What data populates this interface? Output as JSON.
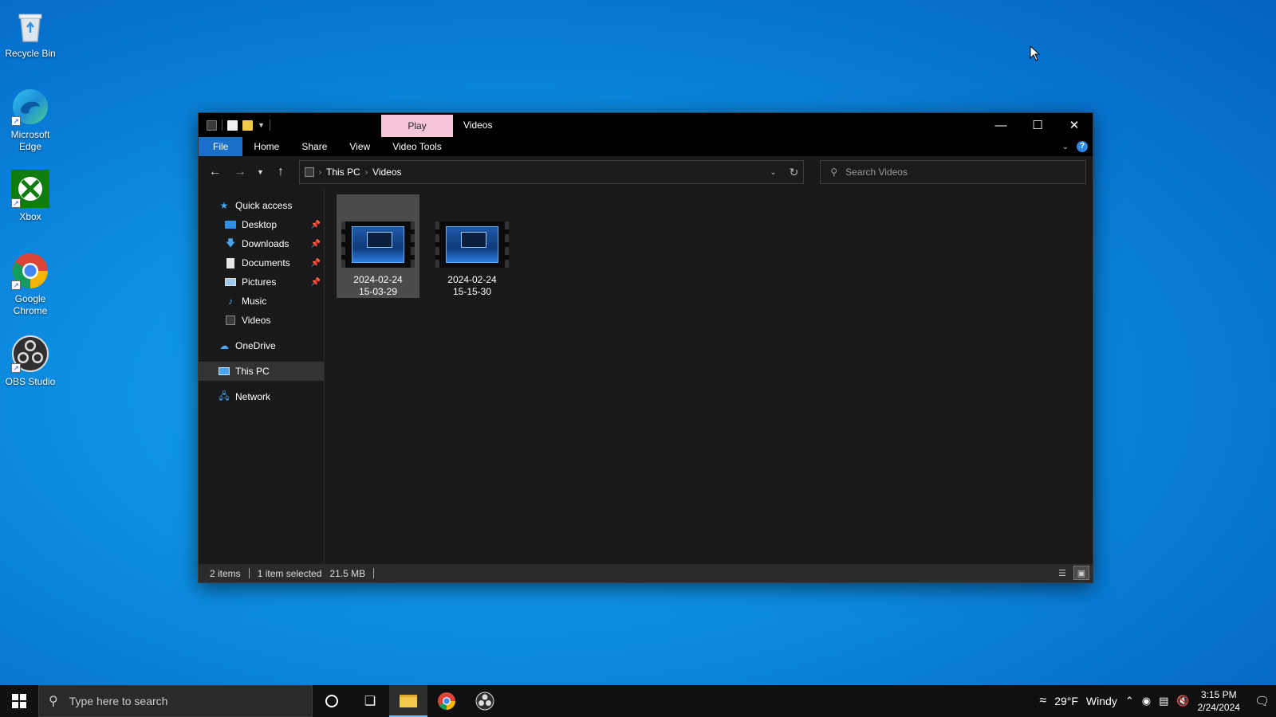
{
  "desktop": {
    "icons": [
      {
        "label": "Recycle Bin",
        "icon": "recycle-bin-icon"
      },
      {
        "label": "Microsoft Edge",
        "icon": "edge-icon"
      },
      {
        "label": "Xbox",
        "icon": "xbox-icon"
      },
      {
        "label": "Google Chrome",
        "icon": "chrome-icon"
      },
      {
        "label": "OBS Studio",
        "icon": "obs-icon"
      }
    ]
  },
  "window": {
    "title": "Videos",
    "context_tab": "Play",
    "ribbon_tabs": [
      "File",
      "Home",
      "Share",
      "View",
      "Video Tools"
    ],
    "breadcrumb": [
      "This PC",
      "Videos"
    ],
    "search_placeholder": "Search Videos",
    "nav": {
      "quick_access": "Quick access",
      "pinned": [
        "Desktop",
        "Downloads",
        "Documents",
        "Pictures"
      ],
      "unpinned": [
        "Music",
        "Videos"
      ],
      "onedrive": "OneDrive",
      "this_pc": "This PC",
      "network": "Network"
    },
    "files": [
      {
        "name_line1": "2024-02-24",
        "name_line2": "15-03-29",
        "selected": true
      },
      {
        "name_line1": "2024-02-24",
        "name_line2": "15-15-30",
        "selected": false
      }
    ],
    "status": {
      "count": "2 items",
      "selection": "1 item selected",
      "size": "21.5 MB"
    }
  },
  "taskbar": {
    "search_placeholder": "Type here to search",
    "weather_temp": "29°F",
    "weather_desc": "Windy",
    "time": "3:15 PM",
    "date": "2/24/2024"
  },
  "colors": {
    "file_tab": "#1a6fc9",
    "context_tab": "#f7c5d9",
    "taskbar": "#101010",
    "window_bg": "#191919"
  }
}
